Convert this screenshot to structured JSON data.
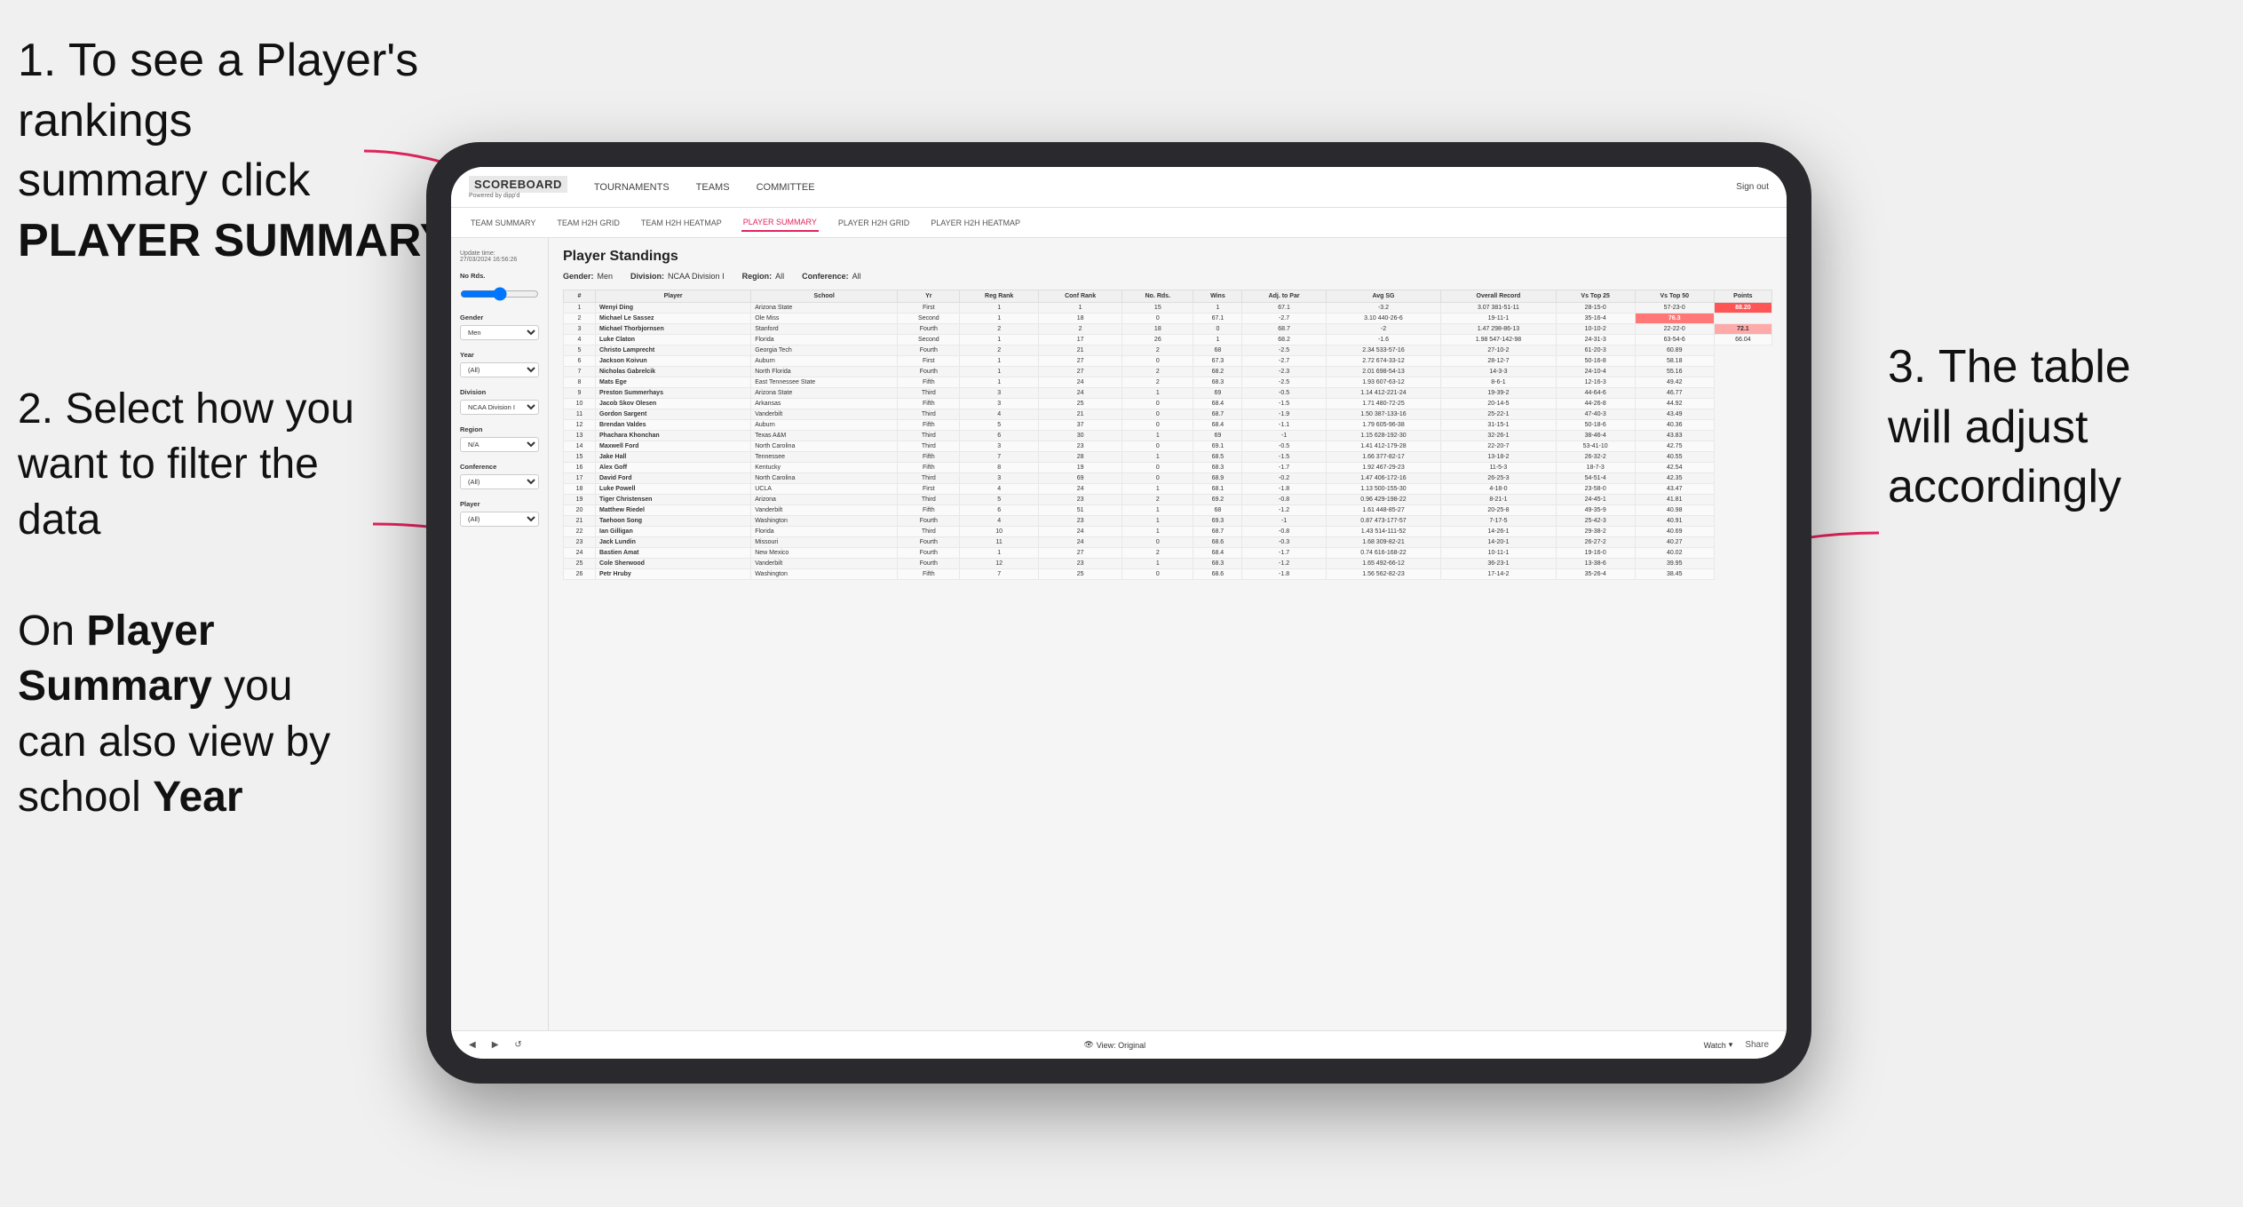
{
  "instructions": {
    "step1": "1. To see a Player's rankings summary click PLAYER SUMMARY",
    "step1_part1": "1. To see a Player's rankings",
    "step1_part2": "summary click ",
    "step1_bold": "PLAYER SUMMARY",
    "step2_part1": "2. Select how you want to filter the data",
    "step3": "3. The table will adjust accordingly",
    "bottom_note_part1": "On ",
    "bottom_note_bold": "Player Summary",
    "bottom_note_part2": " you can also view by school ",
    "bottom_note_bold2": "Year"
  },
  "app": {
    "logo": "SCOREBOARD",
    "logo_sub": "Powered by dipp'd",
    "nav_items": [
      "TOURNAMENTS",
      "TEAMS",
      "COMMITTEE"
    ],
    "nav_right": [
      "Sign out"
    ],
    "sub_nav": [
      "TEAM SUMMARY",
      "TEAM H2H GRID",
      "TEAM H2H HEATMAP",
      "PLAYER SUMMARY",
      "PLAYER H2H GRID",
      "PLAYER H2H HEATMAP"
    ],
    "active_sub": "PLAYER SUMMARY"
  },
  "sidebar": {
    "update_label": "Update time:",
    "update_time": "27/03/2024 16:56:26",
    "no_rds_label": "No Rds.",
    "gender_label": "Gender",
    "gender_value": "Men",
    "year_label": "Year",
    "year_value": "(All)",
    "division_label": "Division",
    "division_value": "NCAA Division I",
    "region_label": "Region",
    "region_value": "N/A",
    "conference_label": "Conference",
    "conference_value": "(All)",
    "player_label": "Player",
    "player_value": "(All)"
  },
  "table": {
    "title": "Player Standings",
    "filters": {
      "gender_label": "Gender:",
      "gender_value": "Men",
      "division_label": "Division:",
      "division_value": "NCAA Division I",
      "region_label": "Region:",
      "region_value": "All",
      "conference_label": "Conference:",
      "conference_value": "All"
    },
    "columns": [
      "#",
      "Player",
      "School",
      "Yr",
      "Reg Rank",
      "Conf Rank",
      "No. Rds.",
      "Wins",
      "Adj. to Par",
      "Avg SG",
      "Overall Record",
      "Vs Top 25",
      "Vs Top 50",
      "Points"
    ],
    "rows": [
      [
        1,
        "Wenyi Ding",
        "Arizona State",
        "First",
        1,
        1,
        15,
        1,
        67.1,
        -3.2,
        "3.07 381-51-11",
        "28-15-0",
        "57-23-0",
        "88.20"
      ],
      [
        2,
        "Michael Le Sassez",
        "Ole Miss",
        "Second",
        1,
        18,
        0,
        67.1,
        -2.7,
        "3.10 440-26-6",
        "19-11-1",
        "35-16-4",
        "76.3"
      ],
      [
        3,
        "Michael Thorbjornsen",
        "Stanford",
        "Fourth",
        2,
        2,
        18,
        0,
        68.7,
        -2.0,
        "1.47 298-86-13",
        "10-10-2",
        "22-22-0",
        "72.1"
      ],
      [
        4,
        "Luke Claton",
        "Florida",
        "Second",
        1,
        17,
        26,
        1,
        68.2,
        -1.6,
        "1.98 547-142-98",
        "24-31-3",
        "63-54-6",
        "66.04"
      ],
      [
        5,
        "Christo Lamprecht",
        "Georgia Tech",
        "Fourth",
        2,
        21,
        2,
        68.0,
        -2.5,
        "2.34 533-57-16",
        "27-10-2",
        "61-20-3",
        "60.89"
      ],
      [
        6,
        "Jackson Koivun",
        "Auburn",
        "First",
        1,
        27,
        0,
        67.3,
        -2.7,
        "2.72 674-33-12",
        "28-12-7",
        "50-16-8",
        "58.18"
      ],
      [
        7,
        "Nicholas Gabrelcik",
        "North Florida",
        "Fourth",
        1,
        27,
        2,
        68.2,
        -2.3,
        "2.01 698-54-13",
        "14-3-3",
        "24-10-4",
        "55.16"
      ],
      [
        8,
        "Mats Ege",
        "East Tennessee State",
        "Fifth",
        1,
        24,
        2,
        68.3,
        -2.5,
        "1.93 607-63-12",
        "8-6-1",
        "12-16-3",
        "49.42"
      ],
      [
        9,
        "Preston Summerhays",
        "Arizona State",
        "Third",
        3,
        24,
        1,
        69.0,
        -0.5,
        "1.14 412-221-24",
        "19-39-2",
        "44-64-6",
        "46.77"
      ],
      [
        10,
        "Jacob Skov Olesen",
        "Arkansas",
        "Fifth",
        3,
        25,
        0,
        68.4,
        -1.5,
        "1.71 480-72-25",
        "20-14-5",
        "44-26-8",
        "44.92"
      ],
      [
        11,
        "Gordon Sargent",
        "Vanderbilt",
        "Third",
        4,
        21,
        0,
        68.7,
        -1.9,
        "1.50 387-133-16",
        "25-22-1",
        "47-40-3",
        "43.49"
      ],
      [
        12,
        "Brendan Valdes",
        "Auburn",
        "Fifth",
        5,
        37,
        0,
        68.4,
        -1.1,
        "1.79 605-96-38",
        "31-15-1",
        "50-18-6",
        "40.36"
      ],
      [
        13,
        "Phachara Khonchan",
        "Texas A&M",
        "Third",
        6,
        30,
        1,
        69.0,
        -1.0,
        "1.15 628-192-30",
        "32-26-1",
        "38-46-4",
        "43.83"
      ],
      [
        14,
        "Maxwell Ford",
        "North Carolina",
        "Third",
        3,
        23,
        0,
        69.1,
        -0.5,
        "1.41 412-179-28",
        "22-20-7",
        "53-41-10",
        "42.75"
      ],
      [
        15,
        "Jake Hall",
        "Tennessee",
        "Fifth",
        7,
        28,
        1,
        68.5,
        -1.5,
        "1.66 377-82-17",
        "13-18-2",
        "26-32-2",
        "40.55"
      ],
      [
        16,
        "Alex Goff",
        "Kentucky",
        "Fifth",
        8,
        19,
        0,
        68.3,
        -1.7,
        "1.92 467-29-23",
        "11-5-3",
        "18-7-3",
        "42.54"
      ],
      [
        17,
        "David Ford",
        "North Carolina",
        "Third",
        3,
        69,
        0,
        68.9,
        -0.2,
        "1.47 406-172-16",
        "26-25-3",
        "54-51-4",
        "42.35"
      ],
      [
        18,
        "Luke Powell",
        "UCLA",
        "First",
        4,
        24,
        1,
        68.1,
        -1.8,
        "1.13 500-155-30",
        "4-18-0",
        "23-58-0",
        "43.47"
      ],
      [
        19,
        "Tiger Christensen",
        "Arizona",
        "Third",
        5,
        23,
        2,
        69.2,
        -0.8,
        "0.96 429-198-22",
        "8-21-1",
        "24-45-1",
        "41.81"
      ],
      [
        20,
        "Matthew Riedel",
        "Vanderbilt",
        "Fifth",
        6,
        51,
        1,
        68.0,
        -1.2,
        "1.61 448-85-27",
        "20-25-8",
        "49-35-9",
        "40.98"
      ],
      [
        21,
        "Taehoon Song",
        "Washington",
        "Fourth",
        4,
        23,
        1,
        69.3,
        -1.0,
        "0.87 473-177-57",
        "7-17-5",
        "25-42-3",
        "40.91"
      ],
      [
        22,
        "Ian Gilligan",
        "Florida",
        "Third",
        10,
        24,
        1,
        68.7,
        -0.8,
        "1.43 514-111-52",
        "14-26-1",
        "29-38-2",
        "40.69"
      ],
      [
        23,
        "Jack Lundin",
        "Missouri",
        "Fourth",
        11,
        24,
        0,
        68.6,
        -0.3,
        "1.68 309-82-21",
        "14-20-1",
        "26-27-2",
        "40.27"
      ],
      [
        24,
        "Bastien Amat",
        "New Mexico",
        "Fourth",
        1,
        27,
        2,
        68.4,
        -1.7,
        "0.74 616-168-22",
        "10-11-1",
        "19-16-0",
        "40.02"
      ],
      [
        25,
        "Cole Sherwood",
        "Vanderbilt",
        "Fourth",
        12,
        23,
        1,
        68.3,
        -1.2,
        "1.65 492-66-12",
        "36-23-1",
        "13-38-6",
        "39.95"
      ],
      [
        26,
        "Petr Hruby",
        "Washington",
        "Fifth",
        7,
        25,
        0,
        68.6,
        -1.8,
        "1.56 562-82-23",
        "17-14-2",
        "35-26-4",
        "38.45"
      ]
    ]
  },
  "toolbar": {
    "view_label": "View: Original",
    "watch_label": "Watch",
    "share_label": "Share"
  }
}
